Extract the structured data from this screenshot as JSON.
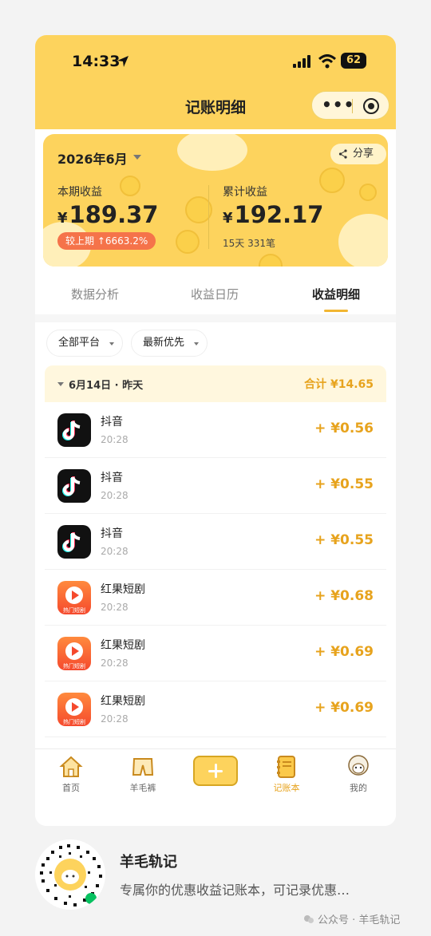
{
  "status_bar": {
    "time": "14:33",
    "battery": "62"
  },
  "nav": {
    "title": "记账明细"
  },
  "summary": {
    "month": "2026年6月",
    "share_label": "分享",
    "period_label": "本期收益",
    "period_yen": "¥",
    "period_amount": "189.37",
    "compare_badge": "较上期 ↑6663.2%",
    "total_label": "累计收益",
    "total_yen": "¥",
    "total_amount": "192.17",
    "total_meta": "15天 331笔"
  },
  "tabs": [
    {
      "label": "数据分析",
      "active": false
    },
    {
      "label": "收益日历",
      "active": false
    },
    {
      "label": "收益明细",
      "active": true
    }
  ],
  "filters": {
    "platform": "全部平台",
    "sort": "最新优先"
  },
  "group": {
    "date": "6月14日 · 昨天",
    "total": "合计 ¥14.65"
  },
  "records": [
    {
      "app": "抖音",
      "time": "20:28",
      "amount": "+ ¥0.56",
      "icon": "tiktok-icon"
    },
    {
      "app": "抖音",
      "time": "20:28",
      "amount": "+ ¥0.55",
      "icon": "tiktok-icon"
    },
    {
      "app": "抖音",
      "time": "20:28",
      "amount": "+ ¥0.55",
      "icon": "tiktok-icon"
    },
    {
      "app": "红果短剧",
      "time": "20:28",
      "amount": "+ ¥0.68",
      "icon": "hongguo-icon",
      "icon_caption": "热门短剧"
    },
    {
      "app": "红果短剧",
      "time": "20:28",
      "amount": "+ ¥0.69",
      "icon": "hongguo-icon",
      "icon_caption": "热门短剧"
    },
    {
      "app": "红果短剧",
      "time": "20:28",
      "amount": "+ ¥0.69",
      "icon": "hongguo-icon",
      "icon_caption": "热门短剧"
    }
  ],
  "tabbar": [
    {
      "label": "首页",
      "icon": "home-icon",
      "active": false
    },
    {
      "label": "羊毛裤",
      "icon": "pants-icon",
      "active": false
    },
    {
      "label": "",
      "icon": "add-icon",
      "active": false
    },
    {
      "label": "记账本",
      "icon": "notebook-icon",
      "active": true
    },
    {
      "label": "我的",
      "icon": "sheep-avatar-icon",
      "active": false
    }
  ],
  "footer": {
    "account_name": "羊毛轨记",
    "description": "专属你的优惠收益记账本，可记录优惠…",
    "watermark": "公众号 · 羊毛轨记"
  },
  "colors": {
    "brand_yellow": "#fdd35d",
    "amount_orange": "#e7a31d",
    "badge_red": "#f5734a"
  }
}
